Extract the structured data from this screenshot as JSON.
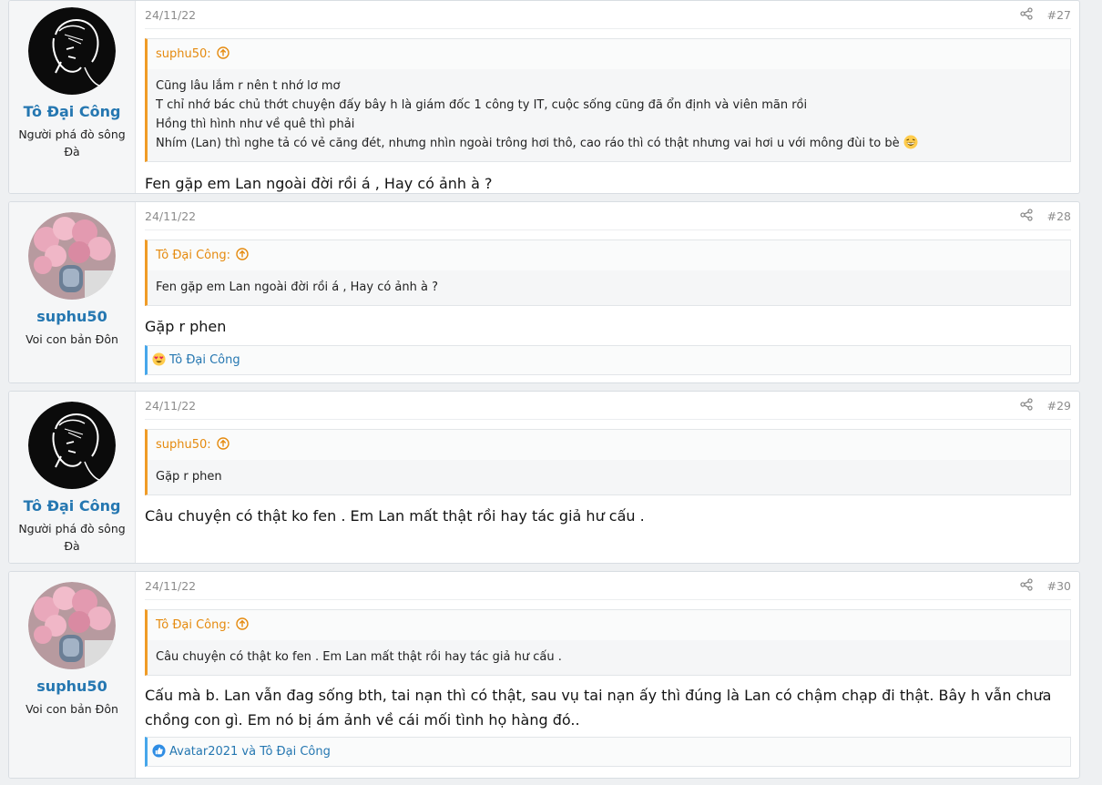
{
  "posts": [
    {
      "author": "Tô Đại Công",
      "user_title": "Người phá đò sông Đà",
      "avatar": "sketch-avatar",
      "date": "24/11/22",
      "number": "#27",
      "quote_author": "suphu50:",
      "quote_lines": [
        "Cũng lâu lắm r nên t nhớ lơ mơ",
        "T chỉ nhớ bác chủ thớt chuyện đấy bây h là giám đốc 1 công ty IT, cuộc sống cũng đã ổn định và viên mãn rồi",
        "Hồng thì hình như về quê thì phải",
        "Nhím (Lan) thì nghe tả có vẻ căng đét, nhưng nhìn ngoài trông hơi thô, cao ráo thì có thật nhưng vai hơi u với mông đùi to bè"
      ],
      "message": "Fen gặp em Lan ngoài đời rồi á , Hay có ảnh à ?"
    },
    {
      "author": "suphu50",
      "user_title": "Voi con bản Đôn",
      "avatar": "flower-avatar",
      "date": "24/11/22",
      "number": "#28",
      "quote_author": "Tô Đại Công:",
      "quote_lines": [
        "Fen gặp em Lan ngoài đời rồi á , Hay có ảnh à ?"
      ],
      "message": "Gặp r phen",
      "reactions": "Tô Đại Công",
      "reaction_icon": "heart-eyes-icon"
    },
    {
      "author": "Tô Đại Công",
      "user_title": "Người phá đò sông Đà",
      "avatar": "sketch-avatar",
      "date": "24/11/22",
      "number": "#29",
      "quote_author": "suphu50:",
      "quote_lines": [
        "Gặp r phen"
      ],
      "message": "Câu chuyện có thật ko fen . Em Lan mất thật rồi hay tác giả hư cấu ."
    },
    {
      "author": "suphu50",
      "user_title": "Voi con bản Đôn",
      "avatar": "flower-avatar",
      "date": "24/11/22",
      "number": "#30",
      "quote_author": "Tô Đại Công:",
      "quote_lines": [
        "Câu chuyện có thật ko fen . Em Lan mất thật rồi hay tác giả hư cấu ."
      ],
      "message": "Cấu mà b. Lan vẫn đag sống bth, tai nạn thì có thật, sau vụ tai nạn ấy thì đúng là Lan có chậm chạp đi thật. Bây h vẫn chưa chồng con gì. Em nó bị ám ảnh về cái mối tình họ hàng đó..",
      "reactions": "Avatar2021 và Tô Đại Công",
      "reaction_icon": "like-icon"
    }
  ],
  "colors": {
    "username": "#2577b1",
    "quote_accent": "#f09c27",
    "reaction_accent": "#47a7eb"
  }
}
